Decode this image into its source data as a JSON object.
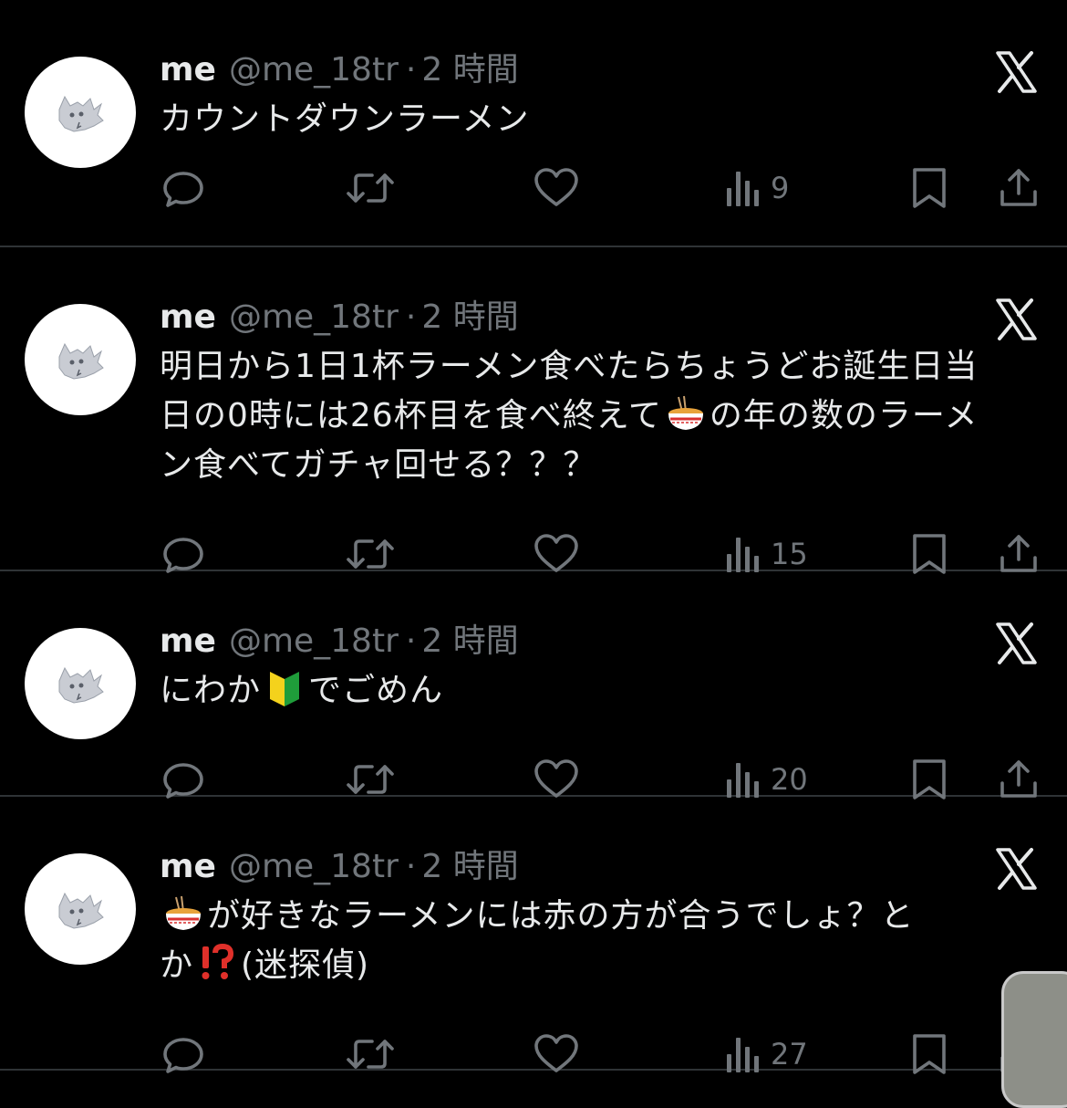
{
  "tweets": [
    {
      "name": "me",
      "handle": "@me_18tr",
      "separator": "·",
      "time": "2 時間",
      "lines": [
        [
          "カウントダウンラーメン"
        ]
      ],
      "views": "9"
    },
    {
      "name": "me",
      "handle": "@me_18tr",
      "separator": "·",
      "time": "2 時間",
      "lines": [
        [
          "明日から1日1杯ラーメン食べたらちょうどお誕生日当"
        ],
        [
          "日の0時には26杯目を食べ終えて",
          "の年の数のラーメ"
        ],
        [
          "ン食べてガチャ回せる？？？"
        ]
      ],
      "views": "15"
    },
    {
      "name": "me",
      "handle": "@me_18tr",
      "separator": "·",
      "time": "2 時間",
      "lines": [
        [
          "にわか",
          "でごめん"
        ]
      ],
      "views": "20"
    },
    {
      "name": "me",
      "handle": "@me_18tr",
      "separator": "·",
      "time": "2 時間",
      "lines": [
        [
          "",
          "が好きなラーメンには赤の方が合うでしょ？と"
        ],
        [
          "か",
          "(迷探偵)"
        ]
      ],
      "views": "27"
    }
  ],
  "icons": {
    "avatar": "cat-avatar",
    "logo": "x-logo-icon",
    "reply": "reply-icon",
    "retweet": "retweet-icon",
    "like": "heart-icon",
    "views": "views-icon",
    "bookmark": "bookmark-icon",
    "share": "share-icon",
    "ramen": "ramen-emoji",
    "beginner": "beginner-mark-emoji",
    "interrobang": "interrobang-emoji"
  },
  "colors": {
    "background": "#000000",
    "text": "#e7e9ea",
    "muted": "#71767b",
    "divider": "#2f3336"
  }
}
